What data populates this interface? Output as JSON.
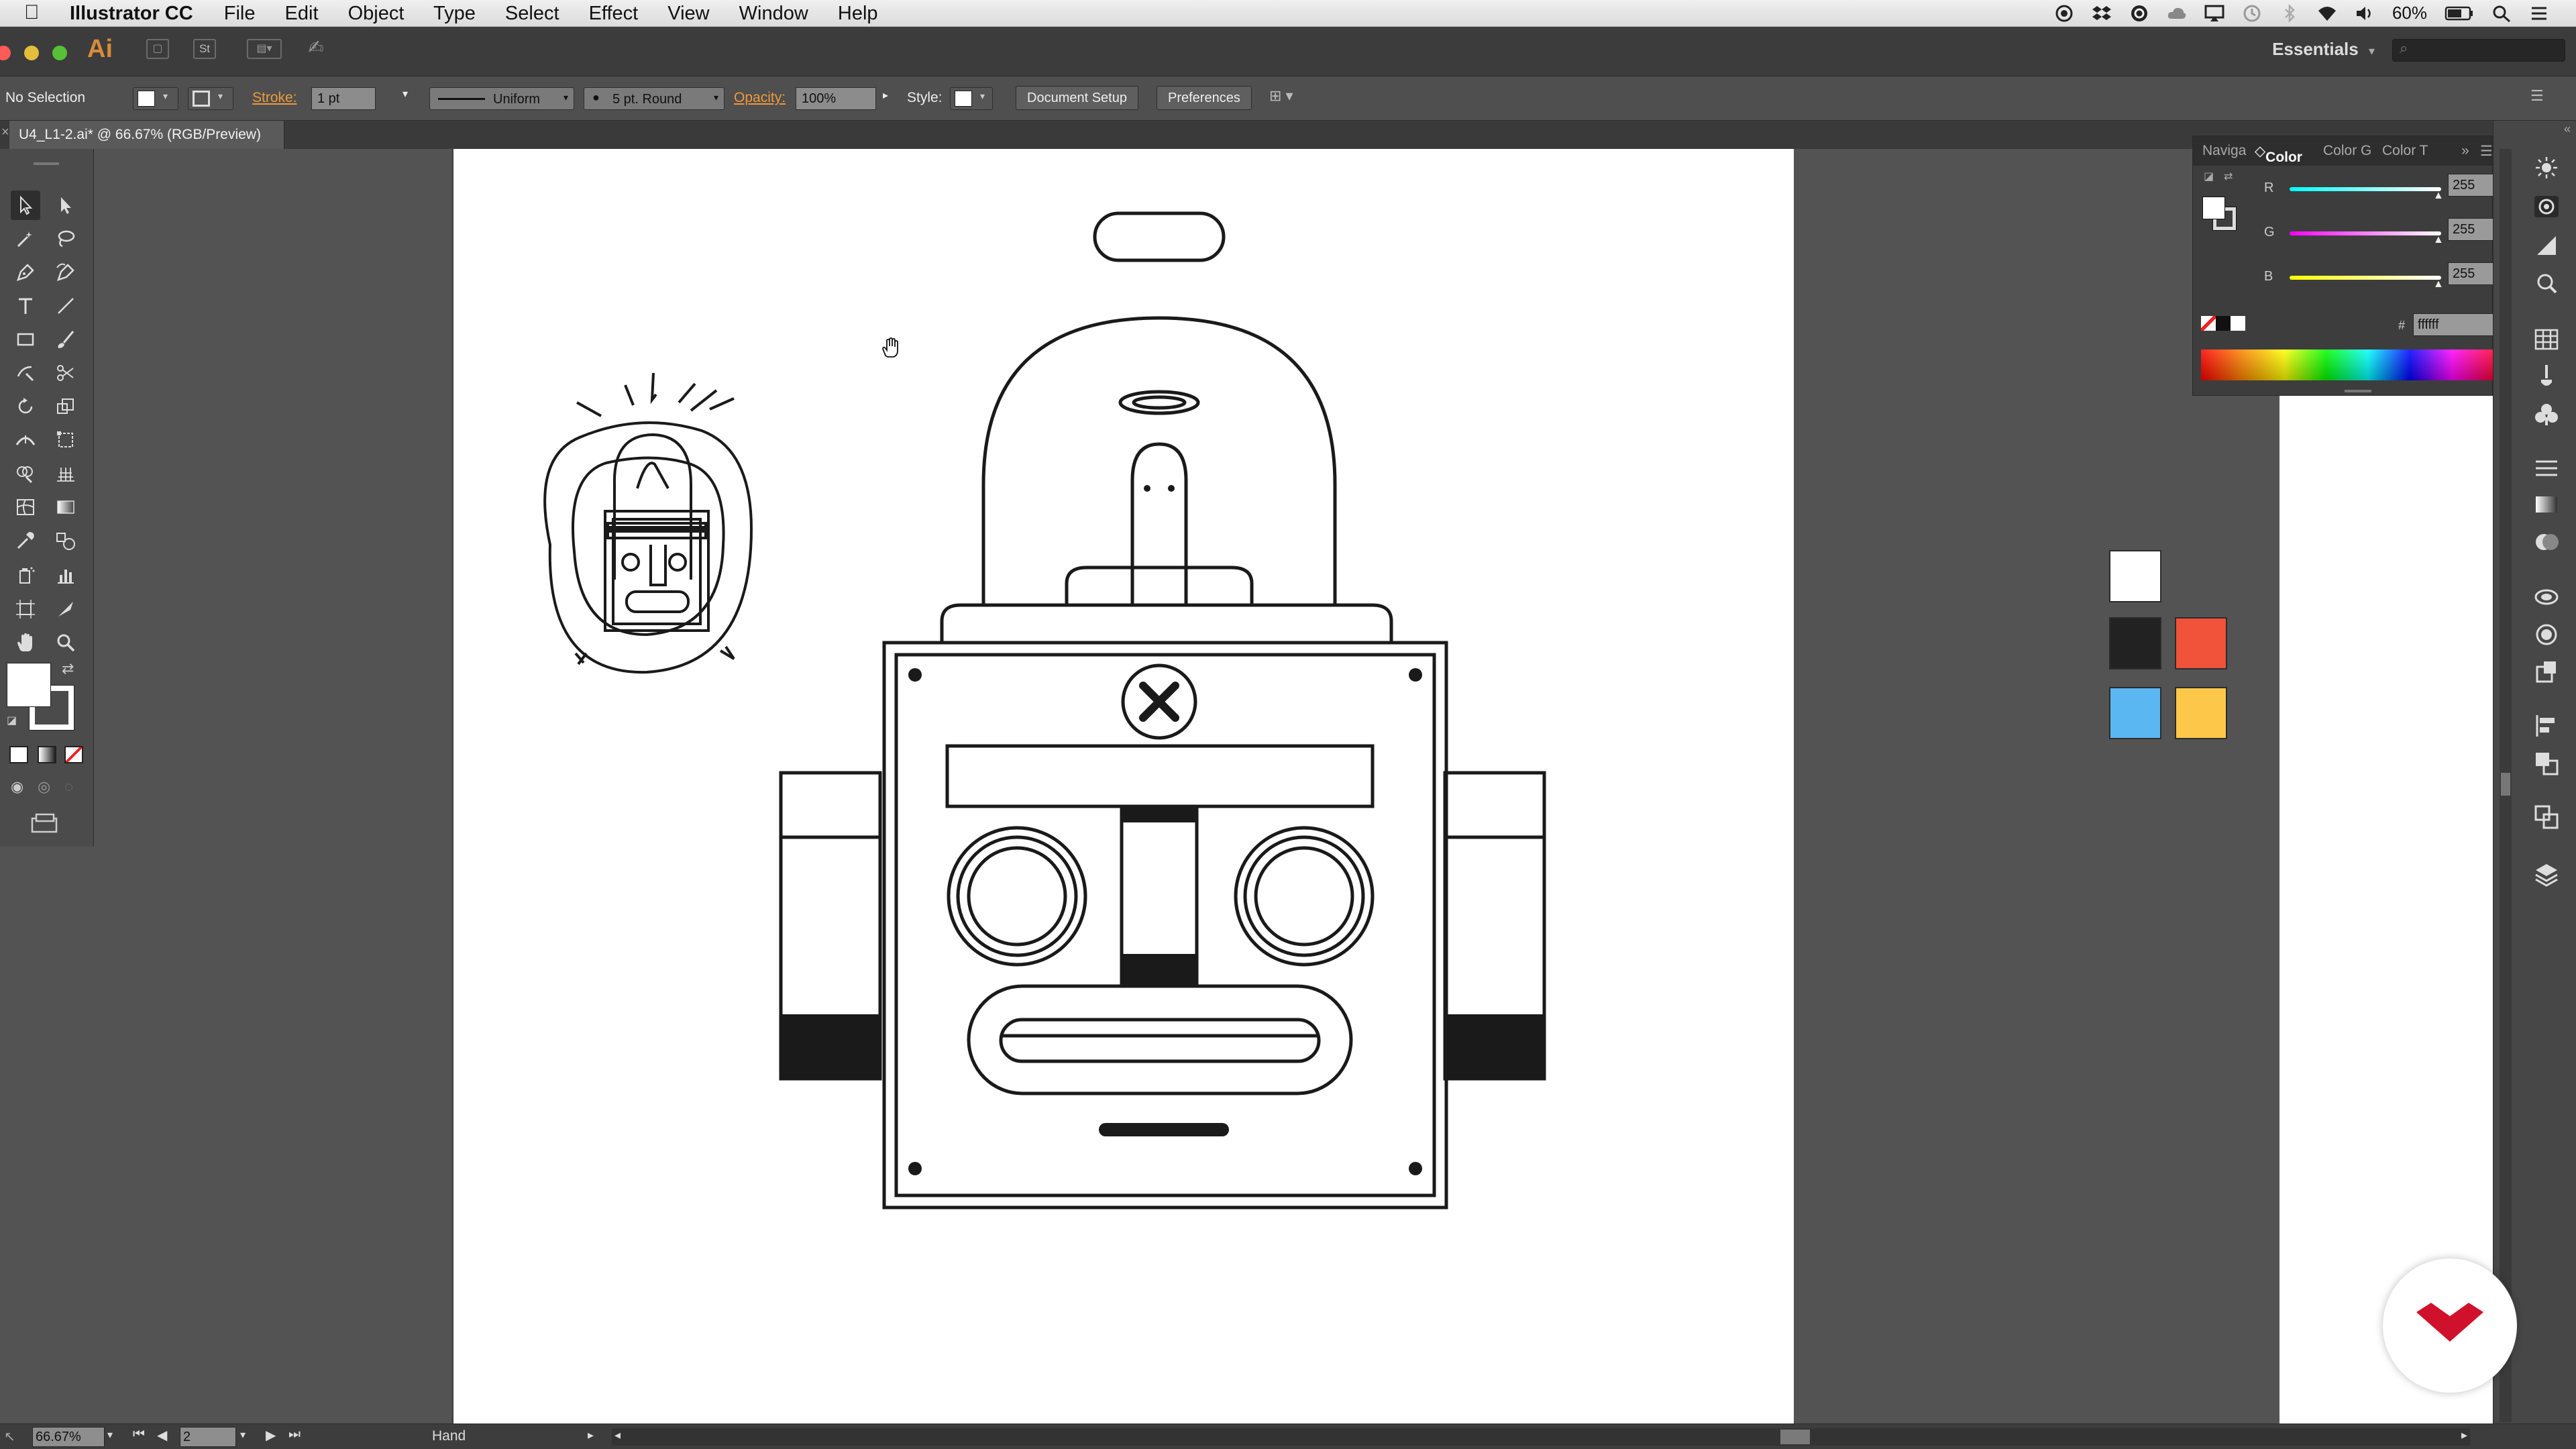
{
  "menubar": {
    "app_name": "Illustrator CC",
    "menus": [
      "File",
      "Edit",
      "Object",
      "Type",
      "Select",
      "Effect",
      "View",
      "Window",
      "Help"
    ],
    "battery": "60%"
  },
  "appbar": {
    "logo": "Ai",
    "st_label": "St",
    "workspace": "Essentials"
  },
  "controlbar": {
    "selection_status": "No Selection",
    "stroke_label": "Stroke:",
    "stroke_weight": "1 pt",
    "profile": "Uniform",
    "brush": "5 pt. Round",
    "opacity_label": "Opacity:",
    "opacity_value": "100%",
    "style_label": "Style:",
    "document_setup": "Document Setup",
    "preferences": "Preferences"
  },
  "document": {
    "tab_title": "U4_L1-2.ai* @ 66.67% (RGB/Preview)"
  },
  "color_panel": {
    "tabs": [
      "Naviga",
      "Color",
      "Color G",
      "Color T"
    ],
    "active_tab": "Color",
    "r_label": "R",
    "r_value": "255",
    "g_label": "G",
    "g_value": "255",
    "b_label": "B",
    "b_value": "255",
    "hex_label": "#",
    "hex_value": "ffffff"
  },
  "swatches": {
    "colors": [
      "#ffffff",
      "#222222",
      "#f1523a",
      "#5bb7f2",
      "#fdc84a"
    ]
  },
  "statusbar": {
    "zoom": "66.67%",
    "page": "2",
    "tool": "Hand"
  },
  "colors": {
    "accent_orange": "#ef9a3c",
    "brand_red": "#d0112b"
  }
}
